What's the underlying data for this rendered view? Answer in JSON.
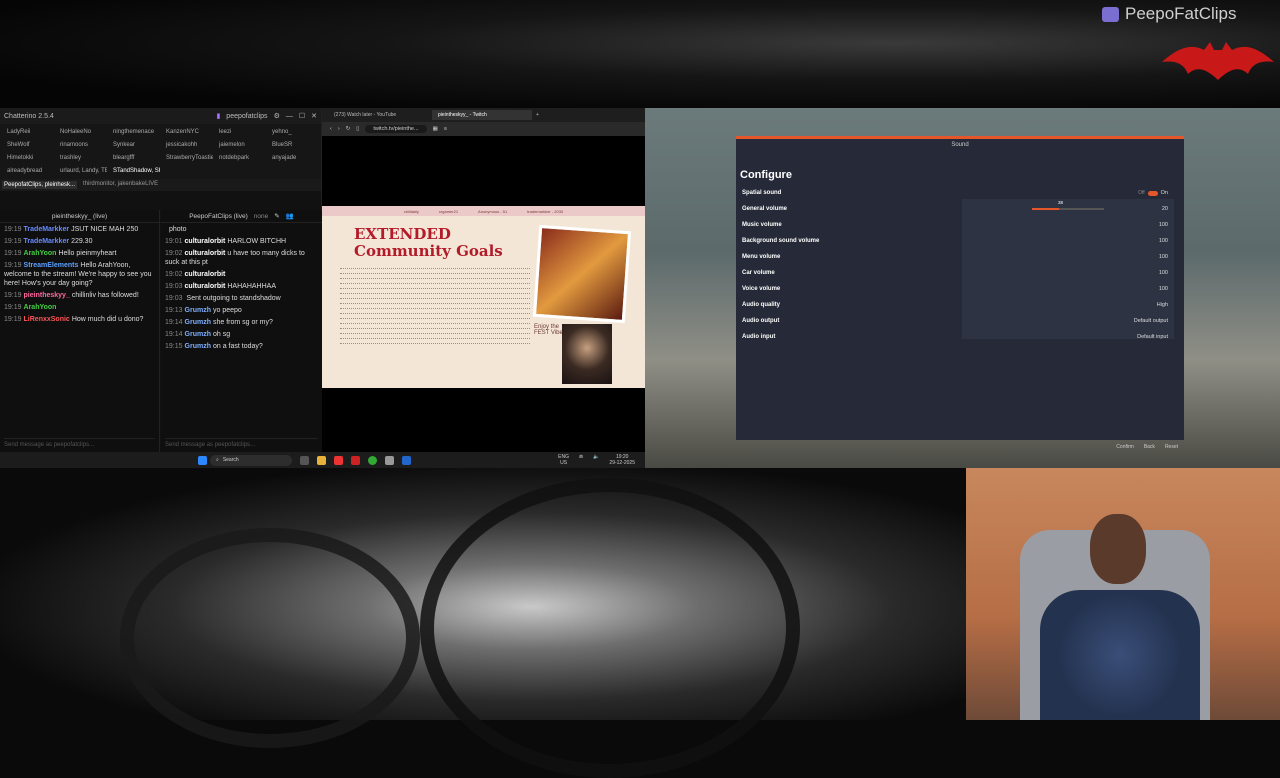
{
  "watermark": {
    "brand": "PeepoFatClips"
  },
  "chatterino": {
    "title": "Chatterino 2.5.4",
    "account": "peepofatclips",
    "tabs": [
      "LadyReii",
      "NoHaleeNo",
      "ningthemenace",
      "KanzenNYC",
      "leezi",
      "yehno_",
      "SheWolf",
      "rinamoons",
      "Synkear",
      "jessicakohh",
      "jaiemelon",
      "BlueSR",
      "Himetokki",
      "trashley",
      "bleargfff",
      "StrawberryToastie",
      "notdebpark",
      "anyajade",
      "alreadybread",
      "urlaurd, Landy, TBEAT, eatal...",
      "STandShadow, SH4RA_, Ver..."
    ],
    "subtabs": [
      "PeepofatClips, pleinhesk...",
      "thirdmonitor, jakenbakeLIVE"
    ],
    "left_split": {
      "channel": "pieintheskyy_ (live)",
      "messages": [
        {
          "time": "19:19",
          "user": "TradeMarkker",
          "text": "JSUT NICE MAH 250",
          "color": "#6a8bff"
        },
        {
          "time": "19:19",
          "user": "TradeMarkker",
          "text": "229.30",
          "color": "#6a8bff"
        },
        {
          "time": "19:19",
          "user": "ArahYoon",
          "text": "Hello pieinmyheart",
          "color": "#44cc44"
        },
        {
          "time": "19:19",
          "user": "StreamElements",
          "text": "Hello ArahYoon, welcome to the stream! We're happy to see you here! How's your day going?",
          "color": "#5fa0ff"
        },
        {
          "time": "19:19",
          "user": "pieintheskyy_",
          "text": "chillinliv has followed!",
          "color": "#ff6aa0"
        },
        {
          "time": "19:19",
          "user": "ArahYoon",
          "text": "",
          "color": "#44cc44"
        },
        {
          "time": "19:19",
          "user": "LiRenxxSonic",
          "text": "How much did u dono?",
          "color": "#ff5555"
        }
      ],
      "input_placeholder": "Send message as peepofatclips..."
    },
    "right_split": {
      "channel": "PeepoFatClips (live)",
      "mode": "none",
      "messages": [
        {
          "time": "",
          "user": "",
          "text": "photo",
          "color": "#ccc"
        },
        {
          "time": "19:01",
          "user": "culturalorbit",
          "text": "HARLOW BITCHH",
          "color": "#ffffff"
        },
        {
          "time": "19:02",
          "user": "culturalorbit",
          "text": "u have too many dicks to suck at this pt",
          "color": "#ffffff"
        },
        {
          "time": "19:02",
          "user": "culturalorbit",
          "text": "",
          "color": "#ffffff"
        },
        {
          "time": "19:03",
          "user": "culturalorbit",
          "text": "HAHAHAHHAA",
          "color": "#ffffff"
        },
        {
          "time": "19:03",
          "user": "",
          "text": "Sent outgoing to standshadow",
          "color": "#888"
        },
        {
          "time": "19:13",
          "user": "Grumzh",
          "text": "yo peepo",
          "color": "#7fb0ff"
        },
        {
          "time": "19:14",
          "user": "Grumzh",
          "text": "she from sg or my?",
          "color": "#7fb0ff"
        },
        {
          "time": "19:14",
          "user": "Grumzh",
          "text": "oh sg",
          "color": "#7fb0ff"
        },
        {
          "time": "19:15",
          "user": "Grumzh",
          "text": "on a fast today?",
          "color": "#7fb0ff"
        }
      ],
      "input_placeholder": "Send message as peepofatclips..."
    }
  },
  "browser": {
    "tabs": [
      "(273) Watch later - YouTube",
      "pieintheskyy_ - Twitch"
    ],
    "url": "twitch.tv/pieinthe...",
    "stream": {
      "title_line1": "EXTENDED",
      "title_line2": "Community Goals",
      "tags": [
        "chilldaily",
        "rzgamer21",
        "Anonymous - 51",
        "trademarkker - 2030"
      ],
      "photo_caption": "Enjoy the FEST Vibes"
    }
  },
  "taskbar": {
    "search": "Search",
    "lang": "ENG",
    "region": "US",
    "time": "19:20",
    "date": "29-12-2025"
  },
  "game": {
    "window_title": "Sound",
    "section": "Configure",
    "rows": [
      {
        "label": "Spatial sound",
        "value": "On"
      },
      {
        "label": "General volume",
        "value": "20"
      },
      {
        "label": "Music volume",
        "value": "100"
      },
      {
        "label": "Background sound volume",
        "value": "100"
      },
      {
        "label": "Menu volume",
        "value": "100"
      },
      {
        "label": "Car volume",
        "value": "100"
      },
      {
        "label": "Voice volume",
        "value": "100"
      },
      {
        "label": "Audio quality",
        "value": "High"
      },
      {
        "label": "Audio output",
        "value": "Default output"
      },
      {
        "label": "Audio input",
        "value": "Default input"
      }
    ],
    "spatial_off": "Off",
    "general_volume_marker": "38",
    "general_volume_fraction": 0.38,
    "footer": [
      "Confirm",
      "Back",
      "Reset"
    ]
  },
  "colors": {
    "accent": "#e3572b",
    "settings_bg": "#262a38",
    "stream_title": "#b31b2a"
  }
}
